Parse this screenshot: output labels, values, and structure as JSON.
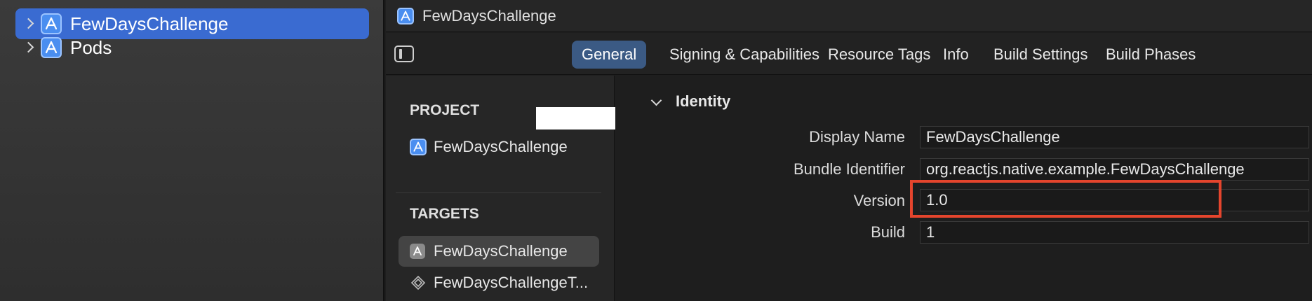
{
  "navigator": {
    "items": [
      {
        "label": "FewDaysChallenge",
        "selected": true
      },
      {
        "label": "Pods",
        "selected": false
      }
    ]
  },
  "header": {
    "title": "FewDaysChallenge"
  },
  "tabs": [
    {
      "label": "General",
      "active": true
    },
    {
      "label": "Signing & Capabilities"
    },
    {
      "label": "Resource Tags"
    },
    {
      "label": "Info"
    },
    {
      "label": "Build Settings"
    },
    {
      "label": "Build Phases"
    }
  ],
  "panel": {
    "project_heading": "PROJECT",
    "project_item": "FewDaysChallenge",
    "targets_heading": "TARGETS",
    "targets": [
      {
        "label": "FewDaysChallenge",
        "selected": true
      },
      {
        "label": "FewDaysChallengeT..."
      }
    ]
  },
  "identity": {
    "title": "Identity",
    "fields": [
      {
        "label": "Display Name",
        "value": "FewDaysChallenge"
      },
      {
        "label": "Bundle Identifier",
        "value": "org.reactjs.native.example.FewDaysChallenge"
      },
      {
        "label": "Version",
        "value": "1.0"
      },
      {
        "label": "Build",
        "value": "1"
      }
    ]
  },
  "colors": {
    "selection": "#3a6bd1",
    "annotation": "#e5452d",
    "active_tab": "#3b5a84"
  }
}
